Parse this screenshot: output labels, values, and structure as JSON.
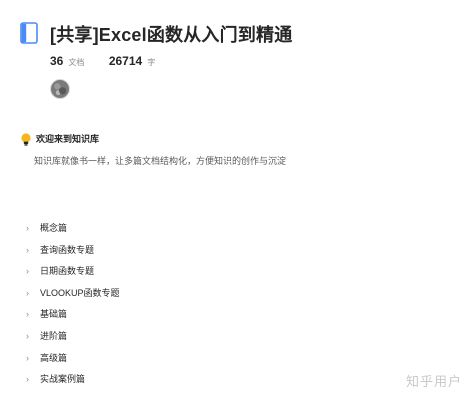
{
  "header": {
    "icon": "book-icon",
    "title": "[共享]Excel函数从入门到精通"
  },
  "stats": {
    "docs_count": "36",
    "docs_unit": "文档",
    "words_count": "26714",
    "words_unit": "字"
  },
  "welcome": {
    "icon": "lightbulb-icon",
    "title": "欢迎来到知识库",
    "description": "知识库就像书一样，让多篇文档结构化，方便知识的创作与沉淀"
  },
  "catalog": {
    "items": [
      {
        "label": "概念篇"
      },
      {
        "label": "查询函数专题"
      },
      {
        "label": "日期函数专题"
      },
      {
        "label": "VLOOKUP函数专题"
      },
      {
        "label": "基础篇"
      },
      {
        "label": "进阶篇"
      },
      {
        "label": "高级篇"
      },
      {
        "label": "实战案例篇"
      }
    ]
  },
  "watermark": "知乎用户",
  "colors": {
    "accent_blue": "#4a8cf5",
    "text_primary": "#262626",
    "text_secondary": "#8c8c8c"
  }
}
